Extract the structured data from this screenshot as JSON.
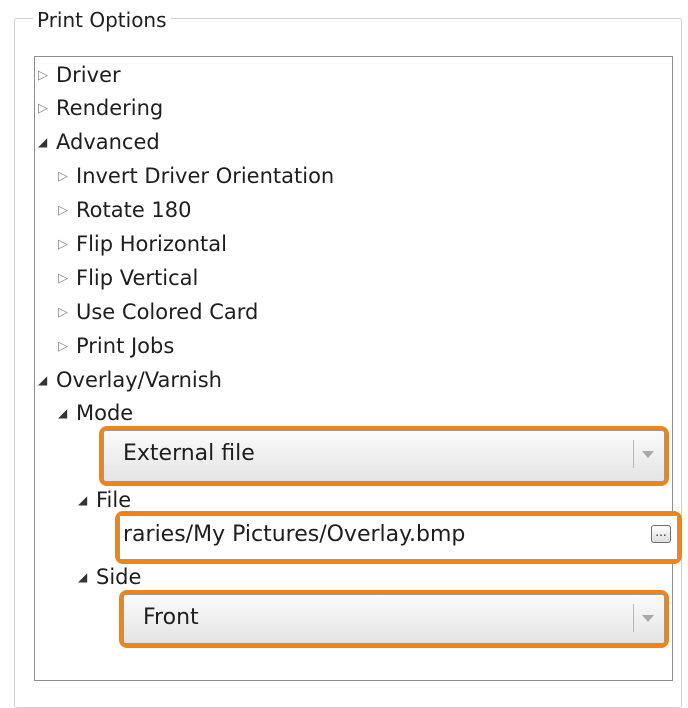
{
  "group": {
    "title": "Print Options"
  },
  "tree": {
    "driver": "Driver",
    "rendering": "Rendering",
    "advanced": "Advanced",
    "invert_driver_orientation": "Invert Driver Orientation",
    "rotate_180": "Rotate 180",
    "flip_horizontal": "Flip Horizontal",
    "flip_vertical": "Flip Vertical",
    "use_colored_card": "Use Colored Card",
    "print_jobs": "Print Jobs",
    "overlay_varnish": "Overlay/Varnish",
    "mode": "Mode",
    "file": "File",
    "side": "Side"
  },
  "controls": {
    "mode_value": "External file",
    "file_value": "raries/My Pictures/Overlay.bmp",
    "browse_label": "...",
    "side_value": "Front"
  },
  "colors": {
    "highlight": "#f08418",
    "tree_border": "#8e8e8e"
  }
}
